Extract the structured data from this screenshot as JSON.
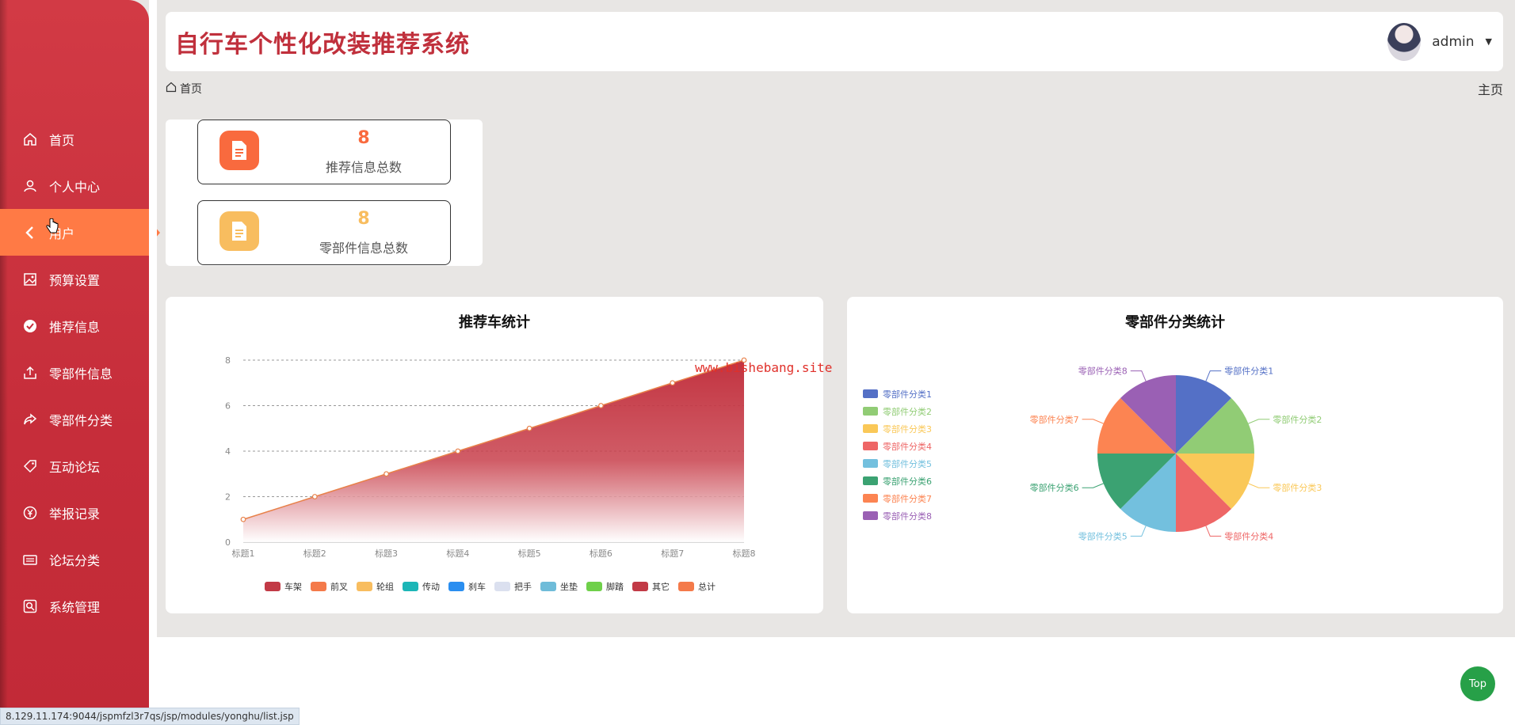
{
  "app": {
    "title": "自行车个性化改装推荐系统"
  },
  "user": {
    "name": "admin"
  },
  "breadcrumb": {
    "home": "首页"
  },
  "header_right": {
    "home_link": "主页"
  },
  "sidebar": {
    "items": [
      {
        "label": "首页",
        "icon": "home-icon"
      },
      {
        "label": "个人中心",
        "icon": "user-icon"
      },
      {
        "label": "用户",
        "icon": "chevron-left-icon",
        "active": true
      },
      {
        "label": "预算设置",
        "icon": "image-icon"
      },
      {
        "label": "推荐信息",
        "icon": "check-circle-icon"
      },
      {
        "label": "零部件信息",
        "icon": "upload-icon"
      },
      {
        "label": "零部件分类",
        "icon": "share-icon"
      },
      {
        "label": "互动论坛",
        "icon": "tag-icon"
      },
      {
        "label": "举报记录",
        "icon": "yen-icon"
      },
      {
        "label": "论坛分类",
        "icon": "keyboard-icon"
      },
      {
        "label": "系统管理",
        "icon": "search-box-icon"
      }
    ]
  },
  "stats": [
    {
      "value": "8",
      "label": "推荐信息总数",
      "color": "#f96a3e"
    },
    {
      "value": "8",
      "label": "零部件信息总数",
      "color": "#f8bd5f"
    }
  ],
  "watermark": "www.bishebang.site",
  "status_url": "8.129.11.174:9044/jspmfzl3r7qs/jsp/modules/yonghu/list.jsp",
  "top_button": "Top",
  "chart_data": [
    {
      "type": "area",
      "title": "推荐车统计",
      "categories": [
        "标题1",
        "标题2",
        "标题3",
        "标题4",
        "标题5",
        "标题6",
        "标题7",
        "标题8"
      ],
      "series": [
        {
          "name": "车架",
          "values": [
            1,
            2,
            3,
            4,
            5,
            6,
            7,
            8
          ],
          "color": "#c23531"
        }
      ],
      "legend": [
        {
          "name": "车架",
          "color": "#c23a46"
        },
        {
          "name": "前叉",
          "color": "#f47a4a"
        },
        {
          "name": "轮组",
          "color": "#f8bd5f"
        },
        {
          "name": "传动",
          "color": "#1cb6b7"
        },
        {
          "name": "刹车",
          "color": "#2a8ef0"
        },
        {
          "name": "把手",
          "color": "#dbe0ef"
        },
        {
          "name": "坐垫",
          "color": "#6fbcd9"
        },
        {
          "name": "脚踏",
          "color": "#6fd04a"
        },
        {
          "name": "其它",
          "color": "#c23a46"
        },
        {
          "name": "总计",
          "color": "#f47a4a"
        }
      ],
      "yticks": [
        "0",
        "2",
        "4",
        "6",
        "8"
      ],
      "ylim": [
        0,
        8
      ],
      "legend_position": "bottom"
    },
    {
      "type": "pie",
      "title": "零部件分类统计",
      "slices": [
        {
          "name": "零部件分类1",
          "value": 1,
          "color": "#5470c6"
        },
        {
          "name": "零部件分类2",
          "value": 1,
          "color": "#91cc75"
        },
        {
          "name": "零部件分类3",
          "value": 1,
          "color": "#fac858"
        },
        {
          "name": "零部件分类4",
          "value": 1,
          "color": "#ee6666"
        },
        {
          "name": "零部件分类5",
          "value": 1,
          "color": "#73c0de"
        },
        {
          "name": "零部件分类6",
          "value": 1,
          "color": "#3ba272"
        },
        {
          "name": "零部件分类7",
          "value": 1,
          "color": "#fc8452"
        },
        {
          "name": "零部件分类8",
          "value": 1,
          "color": "#9a60b4"
        }
      ],
      "legend_position": "left"
    }
  ]
}
